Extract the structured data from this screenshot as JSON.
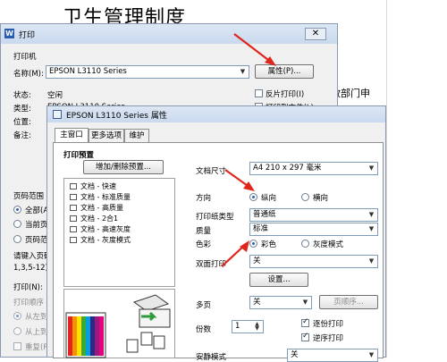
{
  "document": {
    "title": "卫生管理制度",
    "partial_text": "教部门申"
  },
  "print_dialog": {
    "title": "打印",
    "printer_section": "打印机",
    "name_label": "名称(M):",
    "printer_name": "EPSON L3110 Series",
    "properties_button": "属性(P)...",
    "status_label": "状态:",
    "status_value": "空闲",
    "type_label": "类型:",
    "type_value": "EPSON L3110 Series",
    "location_label": "位置:",
    "comment_label": "备注:",
    "reverse_print": "反片打印(I)",
    "print_to_file": "打印到文件(L)",
    "page_range_label": "页码范围",
    "all_label": "全部(A)",
    "current_page_label": "当前页",
    "pages_label": "页码范围",
    "hint_line1": "请键入页码",
    "hint_line2": "1,3,5-12)。",
    "print_label": "打印(N):",
    "print_order_label": "打印顺序",
    "order_left_to_right": "从左到右",
    "order_top_to_bottom": "从上到下",
    "order_repeat": "重复(R)"
  },
  "epson_dialog": {
    "title": "EPSON L3110 Series 属性",
    "tabs": [
      "主窗口",
      "更多选项",
      "维护"
    ],
    "preset_section": "打印预置",
    "add_remove_button": "增加/删除预置...",
    "presets": [
      "文档 - 快速",
      "文档 - 标准质量",
      "文档 - 高质量",
      "文档 - 2合1",
      "文档 - 高速灰度",
      "文档 - 灰度模式"
    ],
    "doc_size_label": "文档尺寸",
    "doc_size_value": "A4 210 x 297 毫米",
    "orientation_label": "方向",
    "portrait": "纵向",
    "landscape": "横向",
    "paper_type_label": "打印纸类型",
    "paper_type_value": "普通纸",
    "quality_label": "质量",
    "quality_value": "标准",
    "color_label": "色彩",
    "color_option": "彩色",
    "grayscale_option": "灰度模式",
    "duplex_label": "双面打印",
    "duplex_value": "关",
    "settings_button": "设置...",
    "multi_page_label": "多页",
    "multi_page_value": "关",
    "page_order_button": "页顺序...",
    "copies_label": "份数",
    "copies_value": "1",
    "collate_label": "逐份打印",
    "reverse_order_label": "逆序打印",
    "quiet_mode_label": "安静模式",
    "quiet_mode_value": "关"
  },
  "colors": {
    "accent_arrow": "#e0261c",
    "titlebar": "#c9d9ee",
    "dialog_bg": "#f0f0f0"
  }
}
